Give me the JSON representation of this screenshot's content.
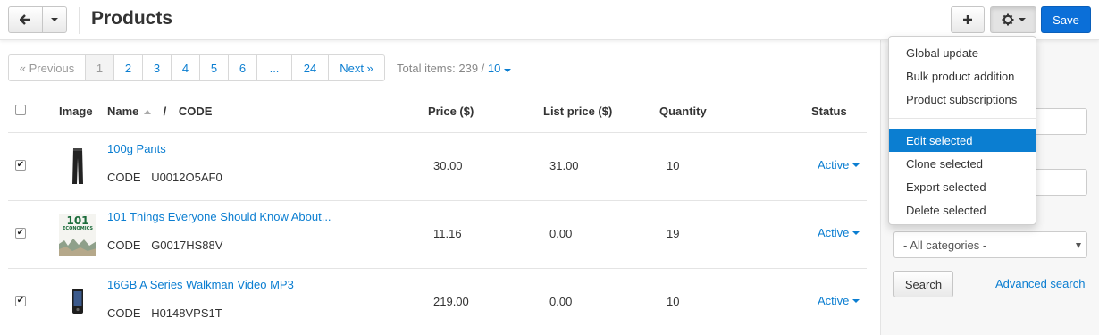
{
  "header": {
    "title": "Products",
    "back_icon": "arrow-left",
    "save_label": "Save",
    "add_icon": "plus",
    "settings_icon": "gear"
  },
  "pagination": {
    "prev": "« Previous",
    "pages": [
      "1",
      "2",
      "3",
      "4",
      "5",
      "6",
      "...",
      "24"
    ],
    "current": "1",
    "next": "Next »",
    "total_label": "Total items: 239 /",
    "per_page": "10"
  },
  "table": {
    "headers": {
      "image": "Image",
      "name": "Name",
      "separator": "/",
      "code": "CODE",
      "price": "Price ($)",
      "list_price": "List price ($)",
      "quantity": "Quantity",
      "status": "Status"
    },
    "rows": [
      {
        "name": "100g Pants",
        "code_label": "CODE",
        "code": "U0012O5AF0",
        "price": "30.00",
        "list_price": "31.00",
        "quantity": "10",
        "status": "Active",
        "checked": true
      },
      {
        "name": "101 Things Everyone Should Know About...",
        "code_label": "CODE",
        "code": "G0017HS88V",
        "price": "11.16",
        "list_price": "0.00",
        "quantity": "19",
        "status": "Active",
        "checked": true
      },
      {
        "name": "16GB A Series Walkman Video MP3",
        "code_label": "CODE",
        "code": "H0148VPS1T",
        "price": "219.00",
        "list_price": "0.00",
        "quantity": "10",
        "status": "Active",
        "checked": true
      }
    ]
  },
  "dropdown": {
    "items": [
      "Global update",
      "Bulk product addition",
      "Product subscriptions",
      "Edit selected",
      "Clone selected",
      "Export selected",
      "Delete selected"
    ],
    "active": "Edit selected"
  },
  "sidebar": {
    "category_select": "- All categories -",
    "search_button": "Search",
    "advanced_search": "Advanced search"
  },
  "thumb_text": {
    "book_number": "101",
    "book_word": "ECONOMICS"
  },
  "colors": {
    "accent": "#0b7ed1",
    "save_button": "#0b6fd8"
  }
}
